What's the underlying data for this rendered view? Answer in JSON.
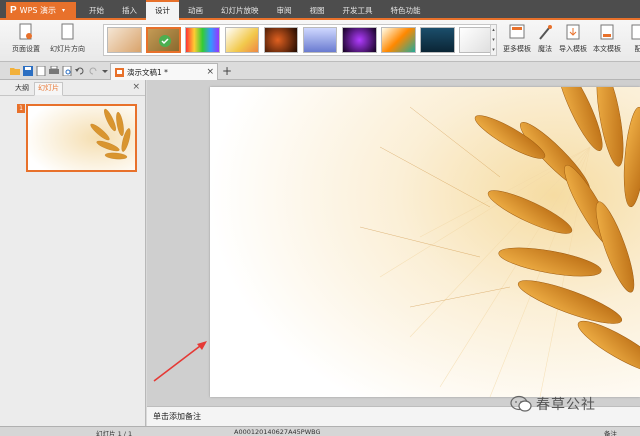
{
  "app": {
    "logo": "P",
    "name": "WPS 演示",
    "caret": "▾",
    "brand_color": "#e8712b"
  },
  "menu": {
    "tabs": [
      "开始",
      "插入",
      "设计",
      "动画",
      "幻灯片放映",
      "审阅",
      "视图",
      "开发工具",
      "特色功能"
    ],
    "active_tab": "设计"
  },
  "ribbon": {
    "page_setup": "页面设置",
    "slide_orientation": "幻灯片方向",
    "more_templates": "更多模板",
    "magic": "魔法",
    "import_template": "导入模板",
    "this_template": "本文模板",
    "cut_label": "配",
    "thumbnail_count": 10,
    "selected_thumbnail": 2
  },
  "document": {
    "tab_title": "演示文稿1 *",
    "close": "×",
    "new_tab": "+"
  },
  "left_panel": {
    "tab_outline": "大纲",
    "tab_slides": "幻灯片",
    "active": "幻灯片",
    "close": "×",
    "slide_number": "1"
  },
  "notes": {
    "placeholder": "单击添加备注"
  },
  "status": {
    "slide_counter": "幻灯片 1 / 1",
    "doc_code": "A000120140627A45PWBG",
    "right_label": "备注"
  },
  "watermark": {
    "text": "春草公社"
  }
}
